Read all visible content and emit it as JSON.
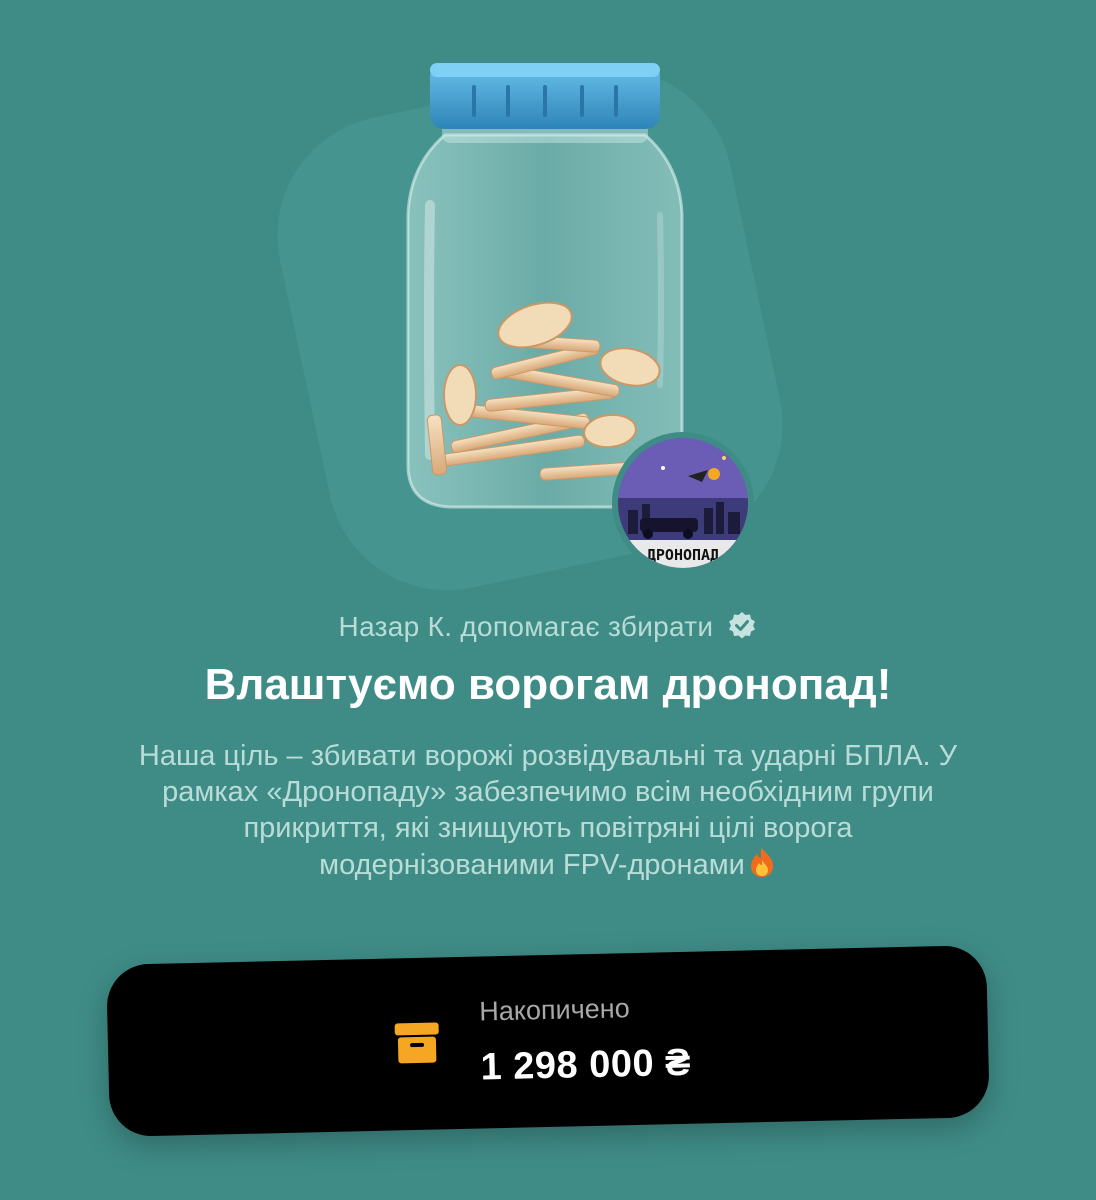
{
  "jar": {
    "helper_text": "Назар К. допомагає збирати",
    "helper_icon": "verified-icon",
    "title": "Влаштуємо ворогам дронопад!",
    "description": "Наша ціль – збивати ворожі розвідувальні та ударні БПЛА. У рамках «Дронопаду» забезпечимо всім необхідним групи прикриття, які знищують повітряні цілі ворога модернізованими FPV-дронами",
    "description_emoji": "fire-icon",
    "avatar_text": "ДРОНОПАД"
  },
  "accumulated": {
    "label": "Накопичено",
    "value": "1 298 000 ₴",
    "icon": "archive-box-icon"
  },
  "colors": {
    "background": "#3f8c87",
    "card": "#000000",
    "accent_orange": "#f5a623",
    "lid_blue": "#4aa8d8"
  }
}
